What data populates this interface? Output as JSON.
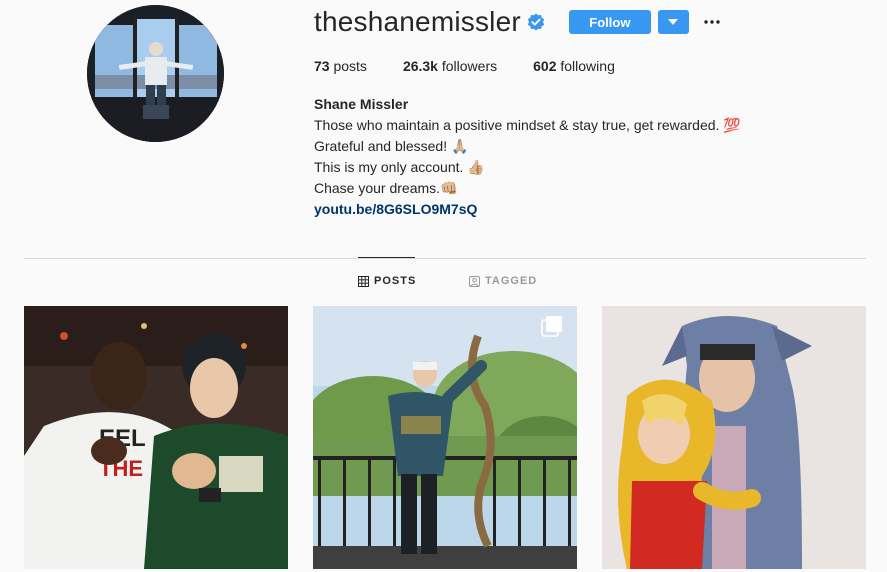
{
  "profile": {
    "username": "theshanemissler",
    "verified": true,
    "follow_label": "Follow",
    "more_label": "•••"
  },
  "stats": {
    "posts_count": "73",
    "posts_label": "posts",
    "followers_count": "26.3k",
    "followers_label": "followers",
    "following_count": "602",
    "following_label": "following"
  },
  "bio": {
    "name": "Shane Missler",
    "lines": [
      "Those who maintain a positive mindset & stay true, get rewarded. 💯",
      "Grateful and blessed! 🙏🏼",
      "This is my only account. 👍🏼",
      "Chase your dreams.👊🏼"
    ],
    "link": "youtu.be/8G6SLO9M7sQ"
  },
  "tabs": [
    {
      "label": "POSTS",
      "active": true,
      "icon": "grid-icon"
    },
    {
      "label": "TAGGED",
      "active": false,
      "icon": "tagged-icon"
    }
  ],
  "posts": [
    {
      "icon": "photo"
    },
    {
      "icon": "photo",
      "multiple": true,
      "badge_icon": "carousel-icon"
    },
    {
      "icon": "photo"
    }
  ],
  "colors": {
    "accent": "#3897f0",
    "link": "#003569",
    "background": "#fafafa",
    "divider": "#dbdbdb"
  }
}
